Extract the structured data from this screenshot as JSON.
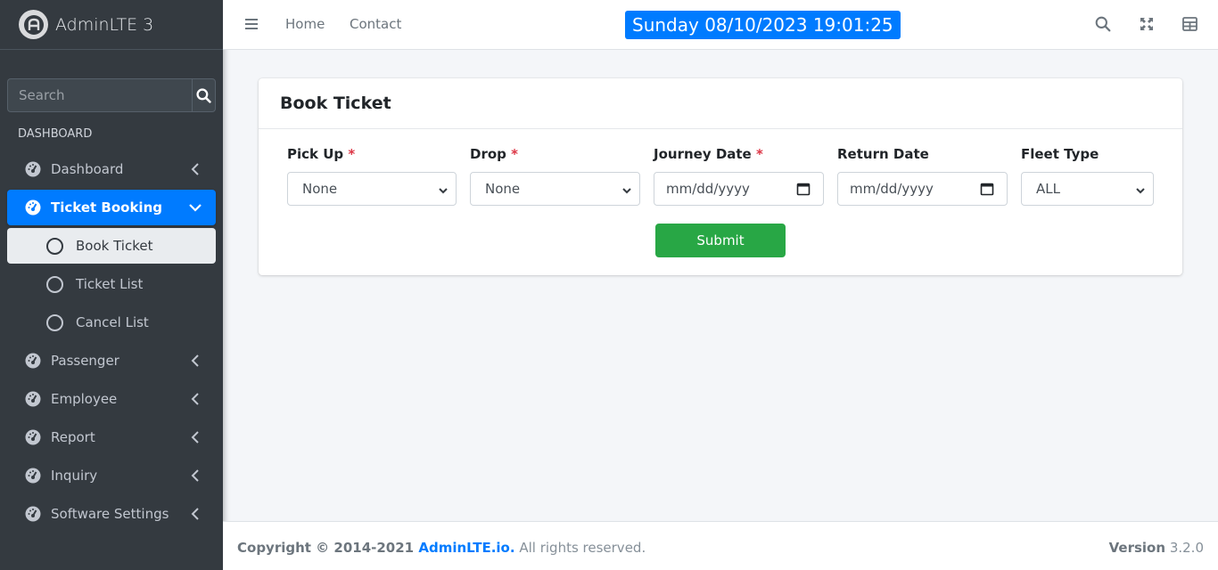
{
  "brand": {
    "name": "AdminLTE 3"
  },
  "sidebar": {
    "search_placeholder": "Search",
    "header": "DASHBOARD",
    "items": [
      {
        "label": "Dashboard",
        "icon": "tachometer-icon"
      },
      {
        "label": "Ticket Booking",
        "icon": "tachometer-icon",
        "active": true,
        "children": [
          {
            "label": "Book Ticket",
            "current": true
          },
          {
            "label": "Ticket List"
          },
          {
            "label": "Cancel List"
          }
        ]
      },
      {
        "label": "Passenger",
        "icon": "tachometer-icon"
      },
      {
        "label": "Employee",
        "icon": "tachometer-icon"
      },
      {
        "label": "Report",
        "icon": "tachometer-icon"
      },
      {
        "label": "Inquiry",
        "icon": "tachometer-icon"
      },
      {
        "label": "Software Settings",
        "icon": "tachometer-icon"
      }
    ]
  },
  "topbar": {
    "links": [
      "Home",
      "Contact"
    ],
    "datetime": "Sunday 08/10/2023 19:01:25"
  },
  "card": {
    "title": "Book Ticket",
    "fields": [
      {
        "label": "Pick Up",
        "required": true,
        "type": "select",
        "value": "None"
      },
      {
        "label": "Drop",
        "required": true,
        "type": "select",
        "value": "None"
      },
      {
        "label": "Journey Date",
        "required": true,
        "type": "date",
        "value": "mm/dd/yyyy"
      },
      {
        "label": "Return Date",
        "required": false,
        "type": "date",
        "value": "mm/dd/yyyy"
      },
      {
        "label": "Fleet Type",
        "required": false,
        "type": "select",
        "value": "ALL"
      }
    ],
    "submit_label": "Submit"
  },
  "footer": {
    "copyright": "Copyright © 2014-2021",
    "brand_link": "AdminLTE.io.",
    "rights": "All rights reserved.",
    "version_label": "Version",
    "version": "3.2.0"
  },
  "colors": {
    "primary": "#007bff",
    "success": "#28a745",
    "danger": "#dc3545",
    "sidebar": "#343a40"
  }
}
